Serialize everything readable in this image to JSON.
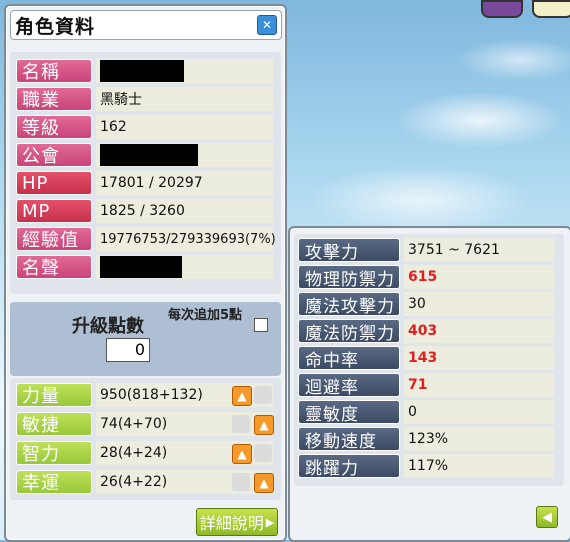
{
  "window": {
    "title": "角色資料"
  },
  "info": [
    {
      "label": "名稱",
      "value": "",
      "redacted": true
    },
    {
      "label": "職業",
      "value": "黑騎士"
    },
    {
      "label": "等級",
      "value": "162"
    },
    {
      "label": "公會",
      "value": "",
      "redacted": true
    },
    {
      "label": "HP",
      "value": "17801 / 20297"
    },
    {
      "label": "MP",
      "value": "1825 / 3260"
    },
    {
      "label": "經驗值",
      "value": "19776753/279339693(7%)"
    },
    {
      "label": "名聲",
      "value": "",
      "redacted": true
    }
  ],
  "ap": {
    "label": "升級點數",
    "value": "0",
    "each_label": "每次追加5點"
  },
  "stats": [
    {
      "label": "力量",
      "value": "950(818+132)"
    },
    {
      "label": "敏捷",
      "value": "74(4+70)"
    },
    {
      "label": "智力",
      "value": "28(4+24)"
    },
    {
      "label": "幸運",
      "value": "26(4+22)"
    }
  ],
  "detail_button": "詳細說明",
  "detail_stats": [
    {
      "label": "攻擊力",
      "value": "3751 ~ 7621",
      "highlight": false
    },
    {
      "label": "物理防禦力",
      "value": "615",
      "highlight": true
    },
    {
      "label": "魔法攻擊力",
      "value": "30",
      "highlight": false
    },
    {
      "label": "魔法防禦力",
      "value": "403",
      "highlight": true
    },
    {
      "label": "命中率",
      "value": "143",
      "highlight": true
    },
    {
      "label": "迴避率",
      "value": "71",
      "highlight": true
    },
    {
      "label": "靈敏度",
      "value": "0",
      "highlight": false
    },
    {
      "label": "移動速度",
      "value": "123%",
      "highlight": false
    },
    {
      "label": "跳躍力",
      "value": "117%",
      "highlight": false
    }
  ],
  "icons": {
    "close": "close-icon",
    "plus": "arrow-up-icon",
    "back": "arrow-left-icon"
  }
}
